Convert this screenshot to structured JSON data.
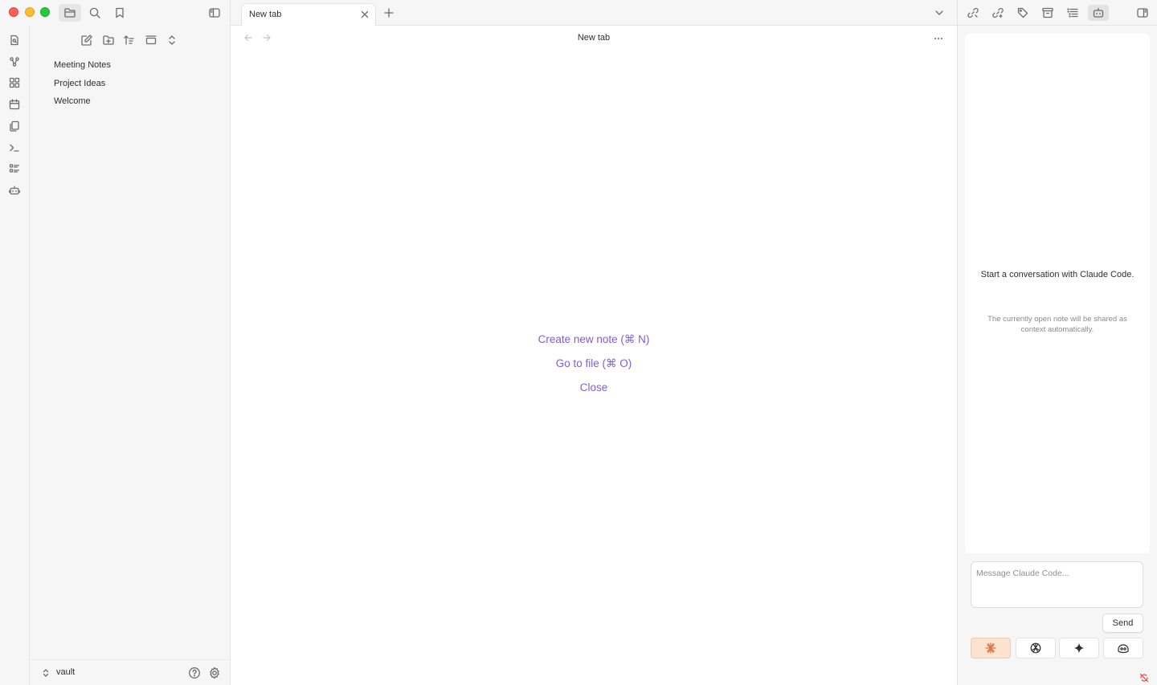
{
  "window": {
    "traffic_lights": [
      "close",
      "minimize",
      "zoom"
    ]
  },
  "left_toolbar": {
    "buttons": [
      "folder-icon",
      "search-icon",
      "bookmark-icon"
    ],
    "active": "folder-icon",
    "sidebar_toggle": "sidebar-left-icon"
  },
  "ribbon": {
    "items": [
      "open-quick-switcher-icon",
      "graph-view-icon",
      "canvas-icon",
      "calendar-icon",
      "copy-icon",
      "terminal-icon",
      "list-icon",
      "bot-icon"
    ]
  },
  "file_explorer": {
    "nav_buttons": [
      "new-note-icon",
      "new-folder-icon",
      "sort-icon",
      "collapse-icon",
      "expand-icon"
    ],
    "files": [
      "Meeting Notes",
      "Project Ideas",
      "Welcome"
    ],
    "vault_name": "vault"
  },
  "tabs": {
    "active_tab": "New tab",
    "new_tab_icon": "plus-icon",
    "dropdown_icon": "chevron-down-icon"
  },
  "view": {
    "title": "New tab",
    "actions": [
      {
        "label": "Create new note (⌘ N)"
      },
      {
        "label": "Go to file (⌘ O)"
      },
      {
        "label": "Close"
      }
    ],
    "link_color": "#7b5fd6"
  },
  "right_sidebar": {
    "top_buttons": [
      "link-icon",
      "outgoing-links-icon",
      "tag-icon",
      "archive-icon",
      "outline-icon",
      "bot-icon"
    ],
    "active": "bot-icon",
    "chat": {
      "title": "Start a conversation with Claude Code.",
      "subtitle": "The currently open note will be shared as context automatically.",
      "input_placeholder": "Message Claude Code...",
      "send_label": "Send",
      "providers": [
        "claude-icon",
        "openai-icon",
        "sparkle-icon",
        "copilot-icon"
      ],
      "active_provider": "claude-icon",
      "active_provider_color": "#fbe3cf"
    }
  }
}
